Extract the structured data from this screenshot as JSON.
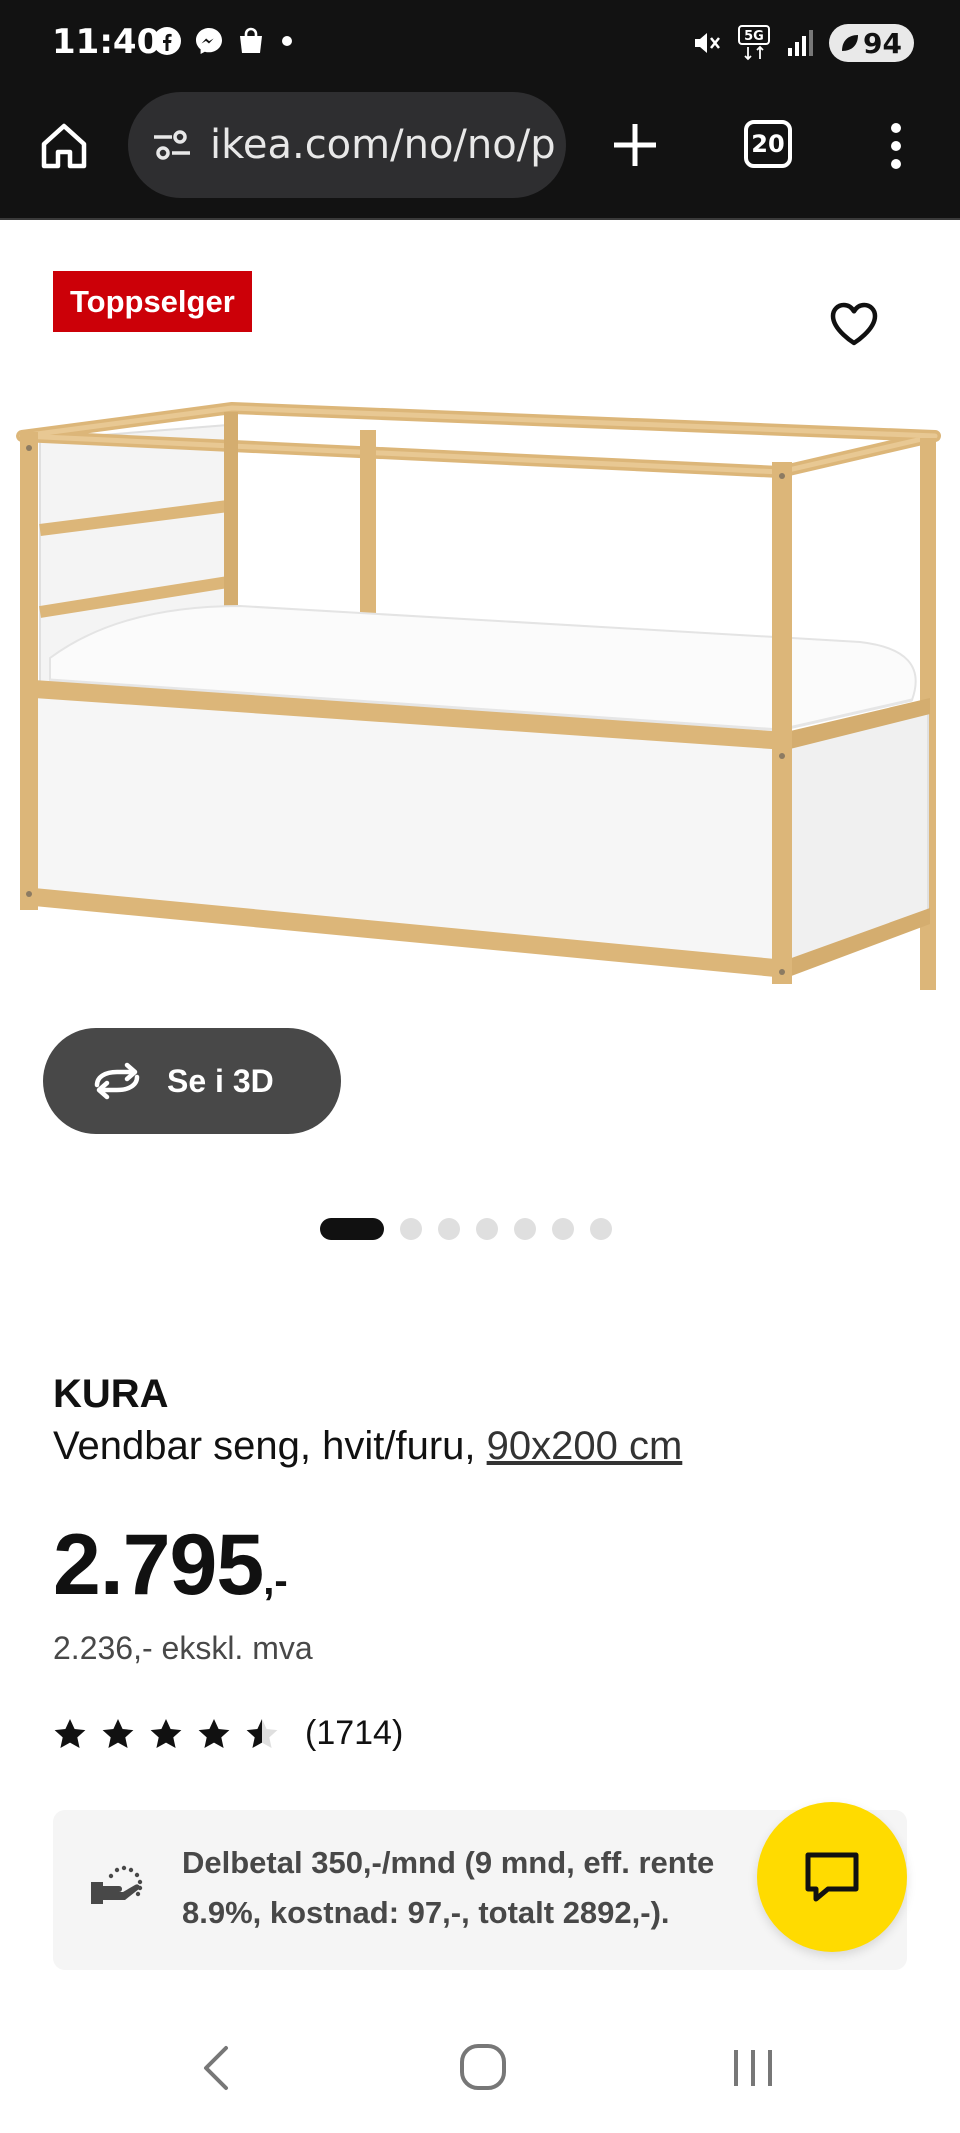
{
  "status_bar": {
    "time": "11:40",
    "notification_icons": [
      "facebook-icon",
      "messenger-icon",
      "shopping-bag-icon",
      "dot-icon"
    ],
    "battery_level": "94",
    "network": "5G"
  },
  "browser": {
    "url": "ikea.com/no/no/p",
    "tab_count": "20"
  },
  "product": {
    "badge": "Toppselger",
    "see_3d_label": "Se i 3D",
    "carousel": {
      "total": 7,
      "active_index": 0
    },
    "name": "KURA",
    "description": "Vendbar seng, hvit/furu, ",
    "size_link": "90x200 cm",
    "price_main": "2.795",
    "price_suffix": ",-",
    "price_ex_vat": "2.236,- ekskl. mva",
    "rating_value": 4.5,
    "rating_count": "(1714)",
    "installment_line1": "Delbetal 350,-/mnd (9 mnd, eff. rente",
    "installment_line2": "8.9%, kostnad: 97,-, totalt 2892,-)."
  },
  "colors": {
    "badge": "#cc0008",
    "chat_button": "#ffdb00",
    "see_3d_button": "#484848",
    "browser_chrome": "#121212"
  }
}
